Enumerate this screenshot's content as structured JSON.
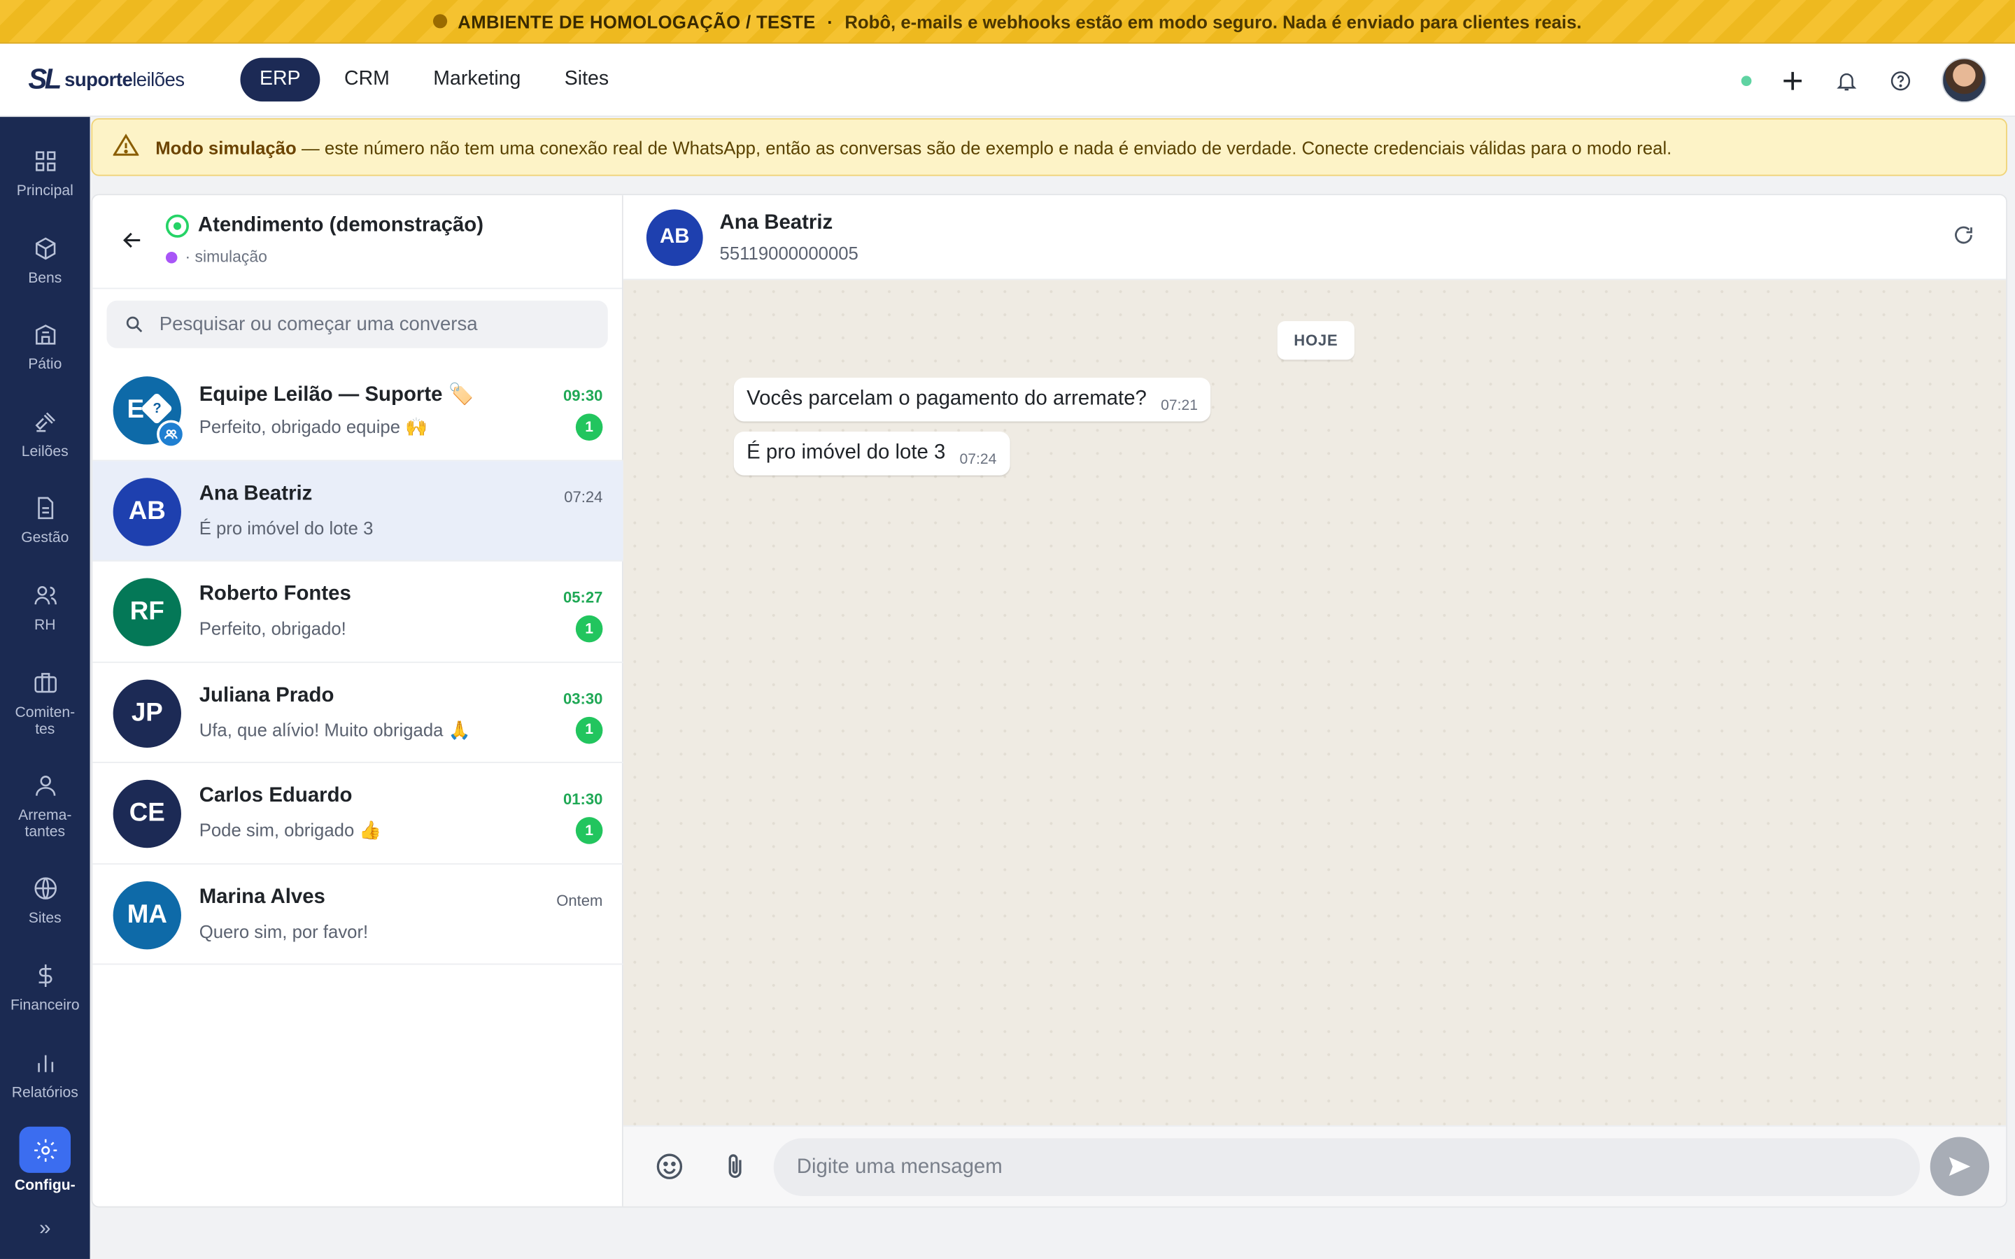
{
  "env_banner": {
    "label": "AMBIENTE DE HOMOLOGAÇÃO / TESTE",
    "separator": "·",
    "message": "Robô, e-mails e webhooks estão em modo seguro. Nada é enviado para clientes reais."
  },
  "header": {
    "logo_mark": "SL",
    "logo_bold": "suporte",
    "logo_rest": "leilões",
    "nav": [
      {
        "label": "ERP",
        "active": true
      },
      {
        "label": "CRM",
        "active": false
      },
      {
        "label": "Marketing",
        "active": false
      },
      {
        "label": "Sites",
        "active": false
      }
    ]
  },
  "sidebar": {
    "items": [
      {
        "label": "Principal",
        "icon": "grid-icon"
      },
      {
        "label": "Bens",
        "icon": "box-icon"
      },
      {
        "label": "Pátio",
        "icon": "building-icon"
      },
      {
        "label": "Leilões",
        "icon": "gavel-icon"
      },
      {
        "label": "Gestão",
        "icon": "document-icon"
      },
      {
        "label": "RH",
        "icon": "users-icon"
      },
      {
        "label": "Comiten-\ntes",
        "icon": "briefcase-icon"
      },
      {
        "label": "Arrema-\ntantes",
        "icon": "user-icon"
      },
      {
        "label": "Sites",
        "icon": "globe-icon"
      },
      {
        "label": "Financeiro",
        "icon": "dollar-icon"
      },
      {
        "label": "Relatórios",
        "icon": "bar-chart-icon"
      },
      {
        "label": "Configu-",
        "icon": "gear-icon",
        "active": true
      }
    ],
    "expand": "»"
  },
  "sim_notice": {
    "title": "Modo simulação",
    "text": "— este número não tem uma conexão real de WhatsApp, então as conversas são de exemplo e nada é enviado de verdade. Conecte credenciais válidas para o modo real."
  },
  "channel": {
    "title": "Atendimento (demonstração)",
    "subtitle": "· simulação"
  },
  "search": {
    "placeholder": "Pesquisar ou começar uma conversa"
  },
  "conversations": [
    {
      "initials": "E",
      "name": "Equipe Leilão — Suporte 🏷️",
      "last": "Perfeito, obrigado equipe 🙌",
      "time": "09:30",
      "unread": "1",
      "color": "#0e6aa8",
      "group": true
    },
    {
      "initials": "AB",
      "name": "Ana Beatriz",
      "last": "É pro imóvel do lote 3",
      "time": "07:24",
      "unread": "",
      "color": "#1e40af",
      "selected": true
    },
    {
      "initials": "RF",
      "name": "Roberto Fontes",
      "last": "Perfeito, obrigado!",
      "time": "05:27",
      "unread": "1",
      "color": "#047857"
    },
    {
      "initials": "JP",
      "name": "Juliana Prado",
      "last": "Ufa, que alívio! Muito obrigada 🙏",
      "time": "03:30",
      "unread": "1",
      "color": "#1c2a55"
    },
    {
      "initials": "CE",
      "name": "Carlos Eduardo",
      "last": "Pode sim, obrigado 👍",
      "time": "01:30",
      "unread": "1",
      "color": "#1c2a55"
    },
    {
      "initials": "MA",
      "name": "Marina Alves",
      "last": "Quero sim, por favor!",
      "time": "Ontem",
      "unread": "",
      "color": "#0e6aa8"
    }
  ],
  "chat": {
    "initials": "AB",
    "name": "Ana Beatriz",
    "phone": "55119000000005",
    "day_label": "HOJE",
    "messages": [
      {
        "text": "Vocês parcelam o pagamento do arremate?",
        "time": "07:21"
      },
      {
        "text": "É pro imóvel do lote 3",
        "time": "07:24"
      }
    ],
    "input_placeholder": "Digite uma mensagem"
  },
  "colors": {
    "brand_navy": "#1c2a55",
    "accent_blue": "#3b6df0",
    "unread_green": "#22c55e",
    "banner_yellow": "#f5c230"
  }
}
